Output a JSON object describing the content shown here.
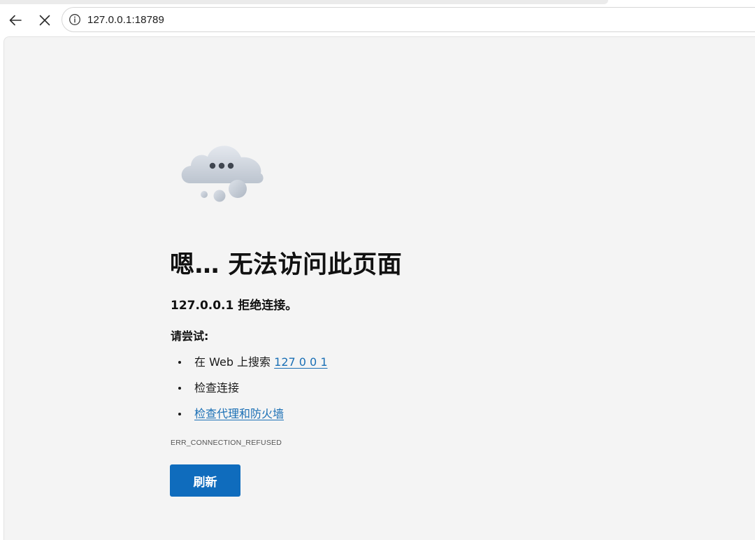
{
  "address_bar": {
    "url": "127.0.0.1:18789",
    "info_icon": "info-icon"
  },
  "toolbar": {
    "back_icon": "back-arrow-icon",
    "stop_icon": "close-icon"
  },
  "error_page": {
    "illustration": "cloud-icon",
    "title": "嗯… 无法访问此页面",
    "subtitle": "127.0.0.1 拒绝连接。",
    "try_heading": "请尝试:",
    "suggestions": [
      {
        "prefix": "在 Web 上搜索 ",
        "link": "127 0 0 1"
      },
      {
        "text": "检查连接"
      },
      {
        "link": "检查代理和防火墙"
      }
    ],
    "error_code": "ERR_CONNECTION_REFUSED",
    "refresh_label": "刷新"
  },
  "colors": {
    "page_background": "#f4f4f4",
    "link": "#1a6fb5",
    "button": "#0f6cbd"
  }
}
